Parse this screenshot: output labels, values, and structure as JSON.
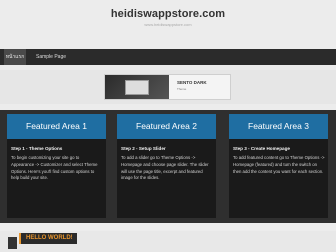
{
  "header": {
    "site_title": "heidiswappstore.com",
    "site_url": "www.heidiswappstore.com"
  },
  "nav": {
    "items": [
      {
        "label": "หน้าแรก"
      },
      {
        "label": "Sample Page"
      }
    ]
  },
  "hero": {
    "title": "SENTO DARK",
    "subtitle": "Theme"
  },
  "features": [
    {
      "heading": "Featured Area 1",
      "step": "Step 1 - Theme Options",
      "text": "To begin customizing your site go to Appearance -> Customizer and select Theme Options. Here's you'll find custom options to help build your site."
    },
    {
      "heading": "Featured Area 2",
      "step": "Step 2 - Setup Slider",
      "text": "To add a slider go to Theme Options -> Homepage and choose page slider. The slider will use the page title, excerpt and featured image for the slides."
    },
    {
      "heading": "Featured Area 3",
      "step": "Step 3 - Create Homepage",
      "text": "To add featured content go to Theme Options -> Homepage (featured) and turn the switch on then add the content you want for each section."
    }
  ],
  "post": {
    "title": "HELLO WORLD!"
  },
  "colors": {
    "feature_header": "#1f6ea2",
    "dark_band": "#2f2f2f",
    "post_accent": "#e8952d"
  }
}
